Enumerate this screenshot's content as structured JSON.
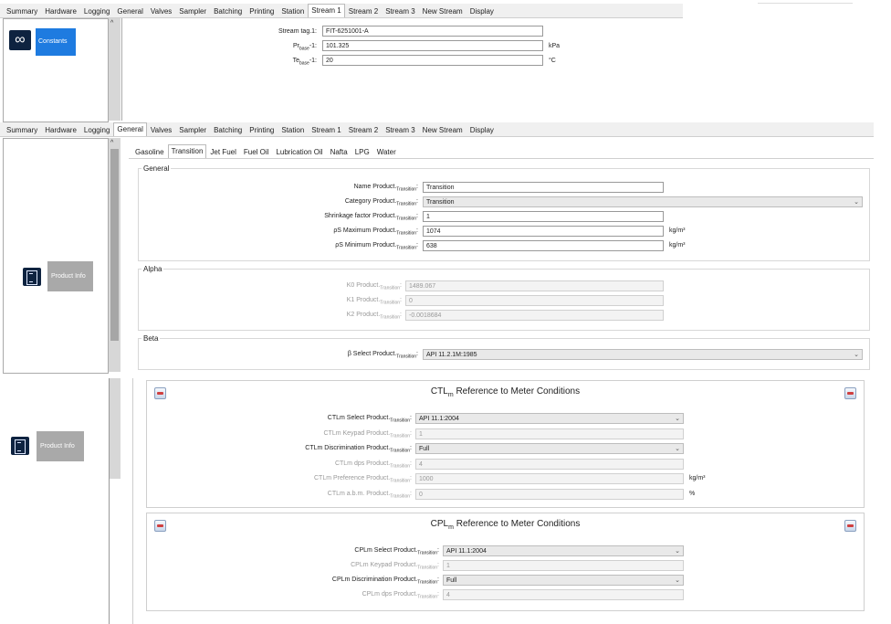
{
  "top": {
    "tabs": [
      "Summary",
      "Hardware",
      "Logging",
      "General",
      "Valves",
      "Sampler",
      "Batching",
      "Printing",
      "Station",
      "Stream 1",
      "Stream 2",
      "Stream 3",
      "New Stream",
      "Display"
    ],
    "active_tab": "Stream 1",
    "sidebar": {
      "button_label": "Constants"
    },
    "fields": [
      {
        "label": "Stream tag.1:",
        "value": "FIT-6251001-A",
        "unit": ""
      },
      {
        "label_main": "Pr",
        "label_sub": "base",
        "label_tail": "-1:",
        "value": "101.325",
        "unit": "kPa"
      },
      {
        "label_main": "Te",
        "label_sub": "base",
        "label_tail": "-1:",
        "value": "20",
        "unit": "°C"
      }
    ]
  },
  "middle": {
    "tabs": [
      "Summary",
      "Hardware",
      "Logging",
      "General",
      "Valves",
      "Sampler",
      "Batching",
      "Printing",
      "Station",
      "Stream 1",
      "Stream 2",
      "Stream 3",
      "New Stream",
      "Display"
    ],
    "active_tab": "General",
    "sidebar": {
      "button_label": "Product Info"
    },
    "product_tabs": [
      "Gasoline",
      "Transition",
      "Jet Fuel",
      "Fuel Oil",
      "Lubrication Oil",
      "Nafta",
      "LPG",
      "Water"
    ],
    "active_product_tab": "Transition",
    "general": {
      "title": "General",
      "rows": [
        {
          "label": "Name Product.",
          "sub": "Transition",
          "value": "Transition",
          "unit": "",
          "kind": "text"
        },
        {
          "label": "Category Product.",
          "sub": "Transition",
          "value": "Transition",
          "unit": "",
          "kind": "select"
        },
        {
          "label": "Shrinkage factor Product.",
          "sub": "Transition",
          "value": "1",
          "unit": "",
          "kind": "text"
        },
        {
          "label": "ρS Maximum Product.",
          "sub": "Transition",
          "value": "1074",
          "unit": "kg/m³",
          "kind": "text"
        },
        {
          "label": "ρS Minimum Product.",
          "sub": "Transition",
          "value": "638",
          "unit": "kg/m³",
          "kind": "text"
        }
      ]
    },
    "alpha": {
      "title": "Alpha",
      "rows": [
        {
          "label": "K0 Product.",
          "sub": "Transition",
          "value": "1489.067"
        },
        {
          "label": "K1 Product.",
          "sub": "Transition",
          "value": "0"
        },
        {
          "label": "K2 Product.",
          "sub": "Transition",
          "value": "-0.0018684"
        }
      ]
    },
    "beta": {
      "title": "Beta",
      "rows": [
        {
          "label": "β Select Product.",
          "sub": "Transition",
          "value": "API 11.2.1M:1985"
        }
      ]
    }
  },
  "bottom": {
    "sidebar": {
      "button_label": "Product Info"
    },
    "ctl": {
      "title_main": "CTL",
      "title_sub": "m",
      "title_tail": " Reference to Meter Conditions",
      "rows": [
        {
          "label": "CTLm Select Product.",
          "sub": "Transition",
          "value": "API 11.1:2004",
          "unit": "",
          "kind": "select",
          "dim": false
        },
        {
          "label": "CTLm Keypad Product.",
          "sub": "Transition",
          "value": "1",
          "unit": "",
          "kind": "dis",
          "dim": true
        },
        {
          "label": "CTLm Discrimination Product.",
          "sub": "Transition",
          "value": "Full",
          "unit": "",
          "kind": "select",
          "dim": false
        },
        {
          "label": "CTLm dps Product.",
          "sub": "Transition",
          "value": "4",
          "unit": "",
          "kind": "dis",
          "dim": true
        },
        {
          "label": "CTLm Preference Product.",
          "sub": "Transition",
          "value": "1000",
          "unit": "kg/m³",
          "kind": "dis",
          "dim": true
        },
        {
          "label": "CTLm a.b.m. Product.",
          "sub": "Transition",
          "value": "0",
          "unit": "%",
          "kind": "dis",
          "dim": true
        }
      ]
    },
    "cpl": {
      "title_main": "CPL",
      "title_sub": "m",
      "title_tail": " Reference to Meter Conditions",
      "rows": [
        {
          "label": "CPLm Select Product.",
          "sub": "Transition",
          "value": "API 11.1:2004",
          "unit": "",
          "kind": "select",
          "dim": false
        },
        {
          "label": "CPLm Keypad Product.",
          "sub": "Transition",
          "value": "1",
          "unit": "",
          "kind": "dis",
          "dim": true
        },
        {
          "label": "CPLm Discrimination Product.",
          "sub": "Transition",
          "value": "Full",
          "unit": "",
          "kind": "select",
          "dim": false
        },
        {
          "label": "CPLm dps Product.",
          "sub": "Transition",
          "value": "4",
          "unit": "",
          "kind": "dis",
          "dim": true
        }
      ]
    }
  }
}
